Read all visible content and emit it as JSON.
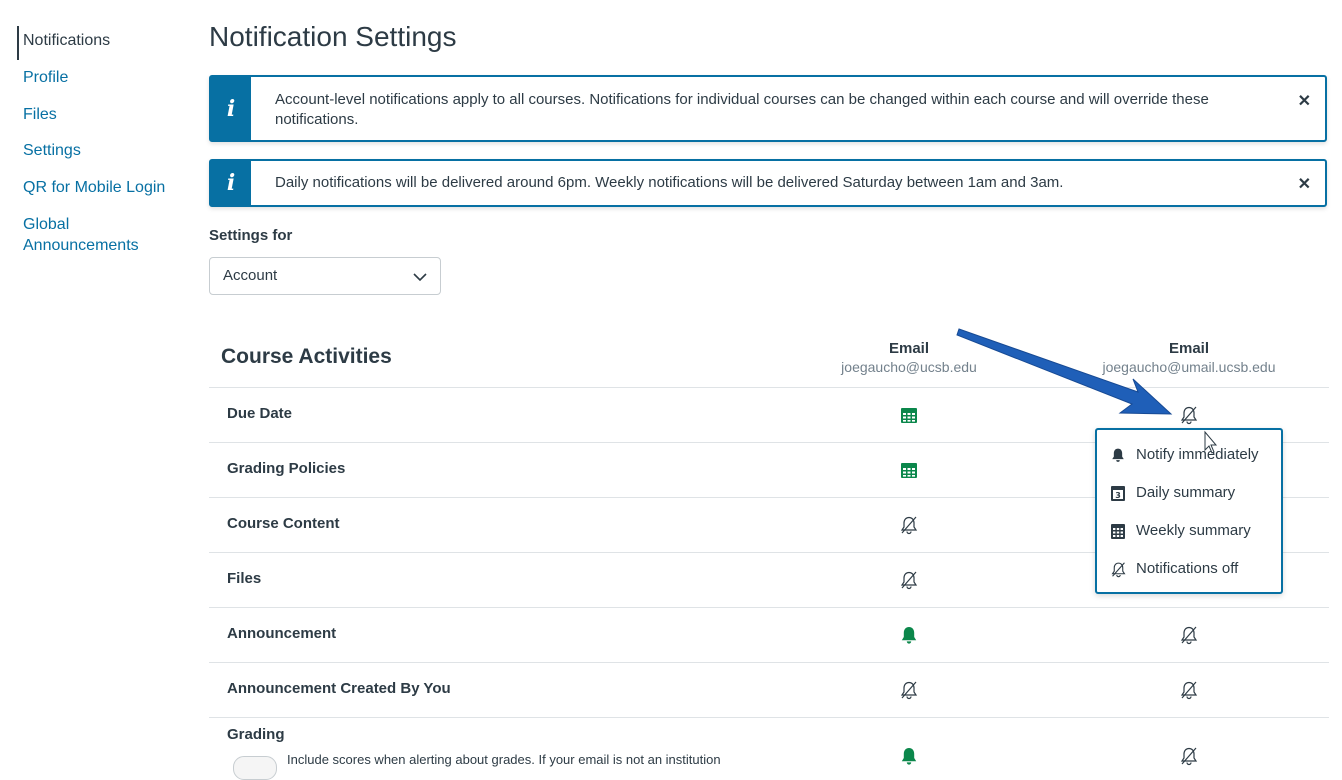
{
  "sidebar": {
    "items": [
      {
        "label": "Notifications",
        "active": true
      },
      {
        "label": "Profile"
      },
      {
        "label": "Files"
      },
      {
        "label": "Settings"
      },
      {
        "label": "QR for Mobile Login"
      },
      {
        "label": "Global Announcements",
        "line1": "Global",
        "line2": "Announcements"
      }
    ]
  },
  "page": {
    "title": "Notification Settings"
  },
  "alerts": [
    {
      "icon": "i",
      "text": "Account-level notifications apply to all courses. Notifications for individual courses can be changed within each course and will override these notifications.",
      "close": "✕"
    },
    {
      "icon": "i",
      "text": "Daily notifications will be delivered around 6pm. Weekly notifications will be delivered Saturday between 1am and 3am.",
      "close": "✕"
    }
  ],
  "settings_for": {
    "label": "Settings for",
    "selected": "Account"
  },
  "table": {
    "section_title": "Course Activities",
    "columns": [
      {
        "header": "Email",
        "address": "joegaucho@ucsb.edu"
      },
      {
        "header": "Email",
        "address": "joegaucho@umail.ucsb.edu"
      }
    ],
    "rows": [
      {
        "label": "Due Date",
        "col1": "weekly-summary-icon",
        "col2": "notifications-off-icon"
      },
      {
        "label": "Grading Policies",
        "col1": "weekly-summary-icon",
        "col2": ""
      },
      {
        "label": "Course Content",
        "col1": "notifications-off-icon",
        "col2": ""
      },
      {
        "label": "Files",
        "col1": "notifications-off-icon",
        "col2": ""
      },
      {
        "label": "Announcement",
        "col1": "notify-immediately-icon",
        "col2": "notifications-off-icon"
      },
      {
        "label": "Announcement Created By You",
        "col1": "notifications-off-icon",
        "col2": "notifications-off-icon"
      },
      {
        "label": "Grading",
        "col1": "notify-immediately-icon",
        "col2": "notifications-off-icon",
        "sublabel": "Include scores when alerting about grades. If your email is not an institution"
      }
    ]
  },
  "menu": {
    "items": [
      {
        "label": "Notify immediately",
        "icon": "bell-icon"
      },
      {
        "label": "Daily summary",
        "icon": "calendar-day-icon"
      },
      {
        "label": "Weekly summary",
        "icon": "calendar-week-icon"
      },
      {
        "label": "Notifications off",
        "icon": "bell-off-icon"
      }
    ]
  },
  "colors": {
    "accent": "#0770a3",
    "green": "#0b874b",
    "text": "#2d3b45",
    "muted": "#73818c",
    "arrow": "#1f5fb8"
  }
}
